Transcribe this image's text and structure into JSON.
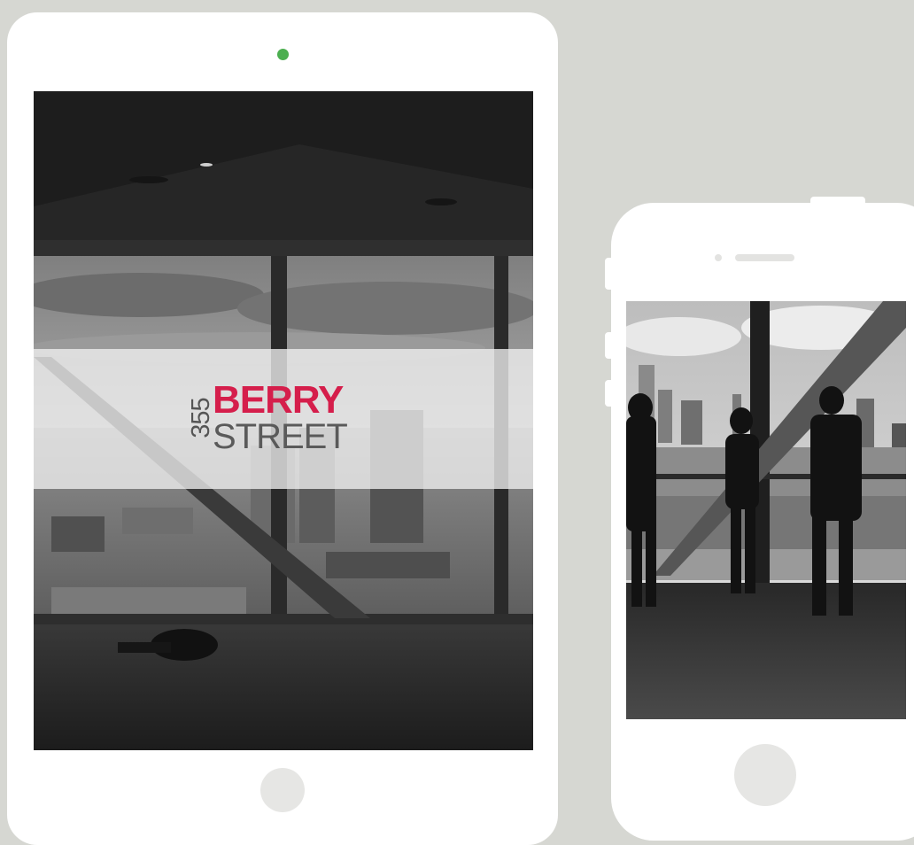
{
  "colors": {
    "background": "#d6d7d2",
    "device_frame": "#ffffff",
    "camera_indicator": "#4caf50",
    "home_button": "#e6e6e4",
    "logo_accent": "#d51e4b",
    "logo_gray": "#5a5a5a"
  },
  "tablet": {
    "scene": "black-and-white office interior with floor-to-ceiling windows overlooking a city",
    "logo": {
      "number": "355",
      "line1": "BERRY",
      "line2": "STREET"
    }
  },
  "phone": {
    "scene": "black-and-white silhouettes of three people talking by floor-to-ceiling windows with city skyline"
  }
}
